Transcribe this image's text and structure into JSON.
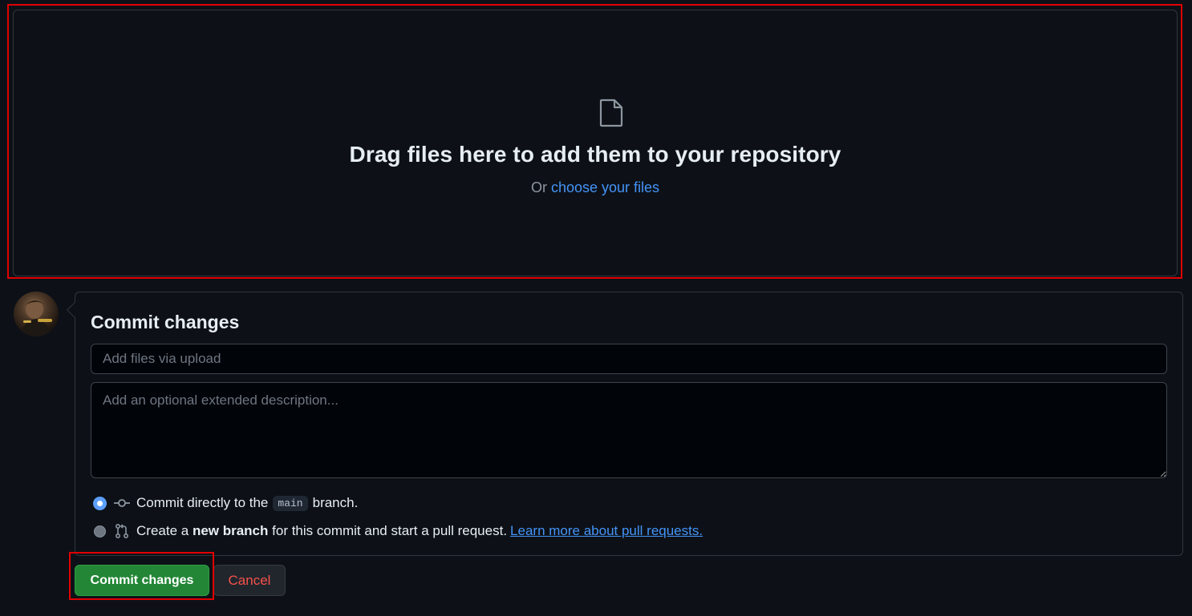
{
  "dropzone": {
    "title": "Drag files here to add them to your repository",
    "or_text": "Or",
    "choose_link": "choose your files"
  },
  "commit": {
    "heading": "Commit changes",
    "summary_placeholder": "Add files via upload",
    "description_placeholder": "Add an optional extended description...",
    "option_direct": {
      "prefix": "Commit directly to the",
      "branch": "main",
      "suffix": "branch.",
      "selected": true
    },
    "option_new_branch": {
      "prefix": "Create a",
      "bold": "new branch",
      "suffix": "for this commit and start a pull request.",
      "link": "Learn more about pull requests.",
      "selected": false
    }
  },
  "buttons": {
    "commit": "Commit changes",
    "cancel": "Cancel"
  },
  "colors": {
    "background": "#0d1117",
    "accent_link": "#4493f8",
    "commit_button": "#238636",
    "cancel_text": "#f85149",
    "annotation_outline": "#e00000"
  },
  "icons": {
    "dropzone": "file-icon",
    "direct_commit": "git-commit-icon",
    "new_branch": "git-pull-request-icon"
  }
}
